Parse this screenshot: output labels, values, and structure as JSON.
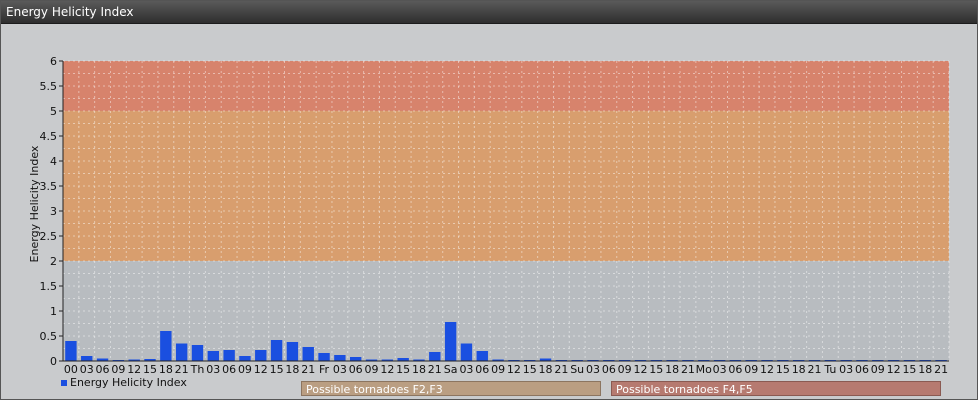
{
  "window": {
    "title": "Energy Helicity Index"
  },
  "chart_data": {
    "type": "bar",
    "title": "",
    "ylabel": "Energy Helicity Index",
    "xlabel": "",
    "ylim": [
      0,
      6
    ],
    "yticks": [
      "0",
      "0.5",
      "1",
      "1.5",
      "2",
      "2.5",
      "3",
      "3.5",
      "4",
      "4.5",
      "5",
      "5.5",
      "6"
    ],
    "grid": true,
    "legend_position": "bottom-left",
    "categories": [
      "00",
      "03",
      "06",
      "09",
      "12",
      "15",
      "18",
      "21",
      "Th",
      "03",
      "06",
      "09",
      "12",
      "15",
      "18",
      "21",
      "Fr",
      "03",
      "06",
      "09",
      "12",
      "15",
      "18",
      "21",
      "Sa",
      "03",
      "06",
      "09",
      "12",
      "15",
      "18",
      "21",
      "Su",
      "03",
      "06",
      "09",
      "12",
      "15",
      "18",
      "21",
      "Mo",
      "03",
      "06",
      "09",
      "12",
      "15",
      "18",
      "21",
      "Tu",
      "03",
      "06",
      "09",
      "12",
      "15",
      "18",
      "21"
    ],
    "series": [
      {
        "name": "Energy Helicity Index",
        "color": "#1a4fe0",
        "values": [
          0.4,
          0.1,
          0.05,
          0.02,
          0.03,
          0.04,
          0.6,
          0.35,
          0.32,
          0.2,
          0.22,
          0.1,
          0.22,
          0.42,
          0.38,
          0.28,
          0.16,
          0.12,
          0.08,
          0.03,
          0.03,
          0.06,
          0.03,
          0.18,
          0.78,
          0.35,
          0.2,
          0.03,
          0.02,
          0.02,
          0.05,
          0.02,
          0.02,
          0.02,
          0.02,
          0.02,
          0.02,
          0.02,
          0.02,
          0.02,
          0.02,
          0.02,
          0.02,
          0.02,
          0.02,
          0.02,
          0.02,
          0.02,
          0.02,
          0.02,
          0.02,
          0.02,
          0.02,
          0.02,
          0.02,
          0.02
        ]
      }
    ],
    "zones": [
      {
        "from": 0,
        "to": 2,
        "color": "#b8bcc0"
      },
      {
        "from": 2,
        "to": 5,
        "color": "#d89e6e",
        "label": "Possible tornadoes F2,F3"
      },
      {
        "from": 5,
        "to": 6,
        "color": "#d7836c",
        "label": "Possible tornadoes F4,F5"
      }
    ]
  }
}
